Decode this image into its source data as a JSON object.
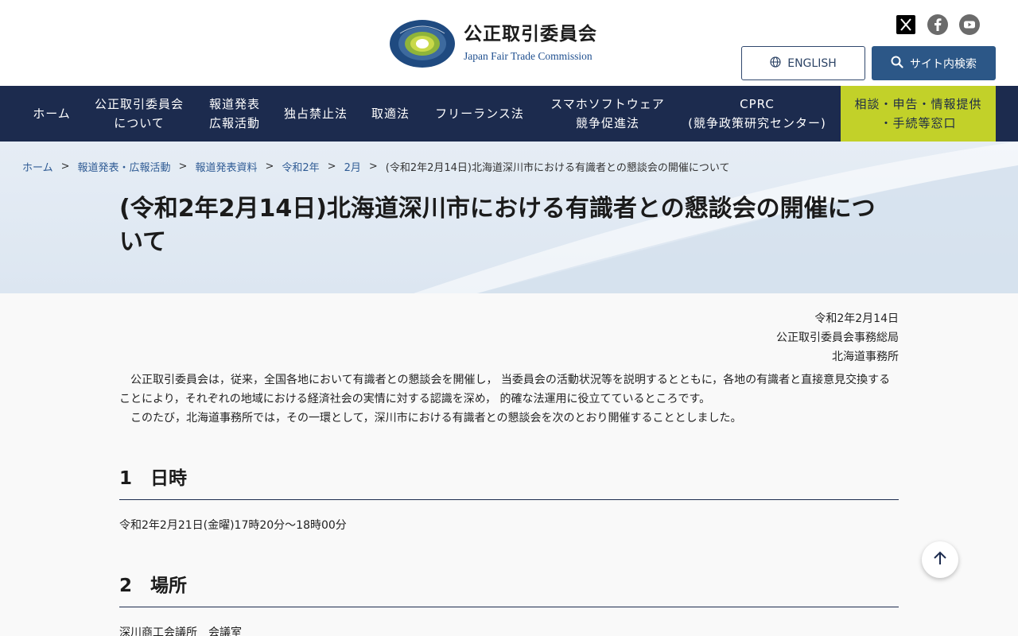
{
  "header": {
    "org_name": "公正取引委員会",
    "org_name_en": "Japan Fair Trade Commission",
    "english_button": "ENGLISH",
    "search_button": "サイト内検索",
    "social": [
      "x-icon",
      "facebook-icon",
      "youtube-icon"
    ]
  },
  "nav": {
    "items": [
      {
        "line1": "ホーム",
        "line2": ""
      },
      {
        "line1": "公正取引委員会",
        "line2": "について"
      },
      {
        "line1": "報道発表",
        "line2": "広報活動"
      },
      {
        "line1": "独占禁止法",
        "line2": ""
      },
      {
        "line1": "取適法",
        "line2": ""
      },
      {
        "line1": "フリーランス法",
        "line2": ""
      },
      {
        "line1": "スマホソフトウェア",
        "line2": "競争促進法"
      },
      {
        "line1": "CPRC",
        "line2": "(競争政策研究センター)"
      }
    ],
    "consult": {
      "line1": "相談・申告・情報提供",
      "line2": "・手続等窓口"
    }
  },
  "breadcrumb": {
    "items": [
      "ホーム",
      "報道発表・広報活動",
      "報道発表資料",
      "令和2年",
      "2月"
    ],
    "current": "(令和2年2月14日)北海道深川市における有識者との懇談会の開催について",
    "separator": ">"
  },
  "page": {
    "title": "(令和2年2月14日)北海道深川市における有識者との懇談会の開催について",
    "date": "令和2年2月14日",
    "issuer1": "公正取引委員会事務総局",
    "issuer2": "北海道事務所",
    "para1": "公正取引委員会は，従来，全国各地において有識者との懇談会を開催し， 当委員会の活動状況等を説明するとともに，各地の有識者と直接意見交換することにより，それぞれの地域における経済社会の実情に対する認識を深め， 的確な法運用に役立てているところです。",
    "para2": "このたび，北海道事務所では，その一環として，深川市における有識者との懇談会を次のとおり開催することとしました。",
    "sections": [
      {
        "heading": "1　日時",
        "body": "令和2年2月21日(金曜)17時20分～18時00分"
      },
      {
        "heading": "2　場所",
        "body": "深川商工会議所　会議室"
      }
    ]
  },
  "colors": {
    "nav_bg": "#1c2b4e",
    "consult_bg": "#c2d129",
    "search_bg": "#2c5787",
    "link": "#2f5b94"
  }
}
